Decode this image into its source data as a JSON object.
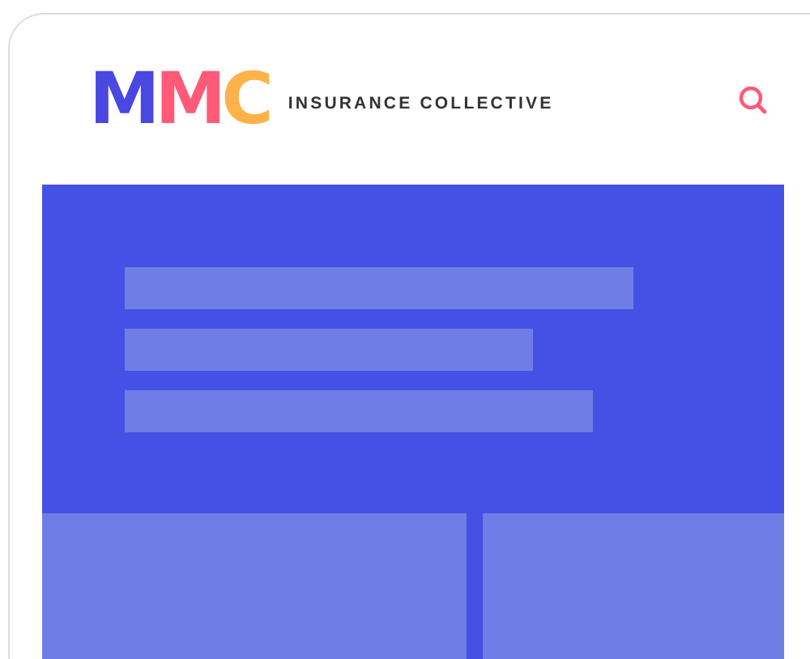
{
  "header": {
    "logo": {
      "text": "MMC"
    },
    "brand_name": "INSURANCE COLLECTIVE"
  }
}
